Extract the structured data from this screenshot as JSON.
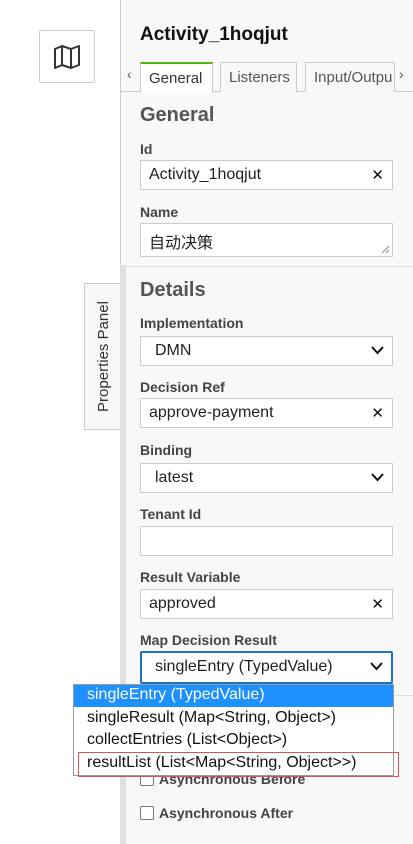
{
  "canvas": {
    "map_icon": "map-icon",
    "properties_panel_toggle": "Properties Panel"
  },
  "panel": {
    "title": "Activity_1hoqjut",
    "tabs": {
      "prev": "‹",
      "next": "›",
      "items": [
        {
          "label": "General",
          "active": true
        },
        {
          "label": "Listeners",
          "active": false
        },
        {
          "label": "Input/Outpu",
          "active": false
        }
      ]
    },
    "general": {
      "title": "General",
      "id_label": "Id",
      "id_value": "Activity_1hoqjut",
      "name_label": "Name",
      "name_value": "自动决策"
    },
    "details": {
      "title": "Details",
      "implementation_label": "Implementation",
      "implementation_value": "DMN",
      "decision_ref_label": "Decision Ref",
      "decision_ref_value": "approve-payment",
      "binding_label": "Binding",
      "binding_value": "latest",
      "tenant_label": "Tenant Id",
      "tenant_value": "",
      "result_var_label": "Result Variable",
      "result_var_value": "approved",
      "map_label": "Map Decision Result",
      "map_value": "singleEntry (TypedValue)",
      "async_before": "Asynchronous Before",
      "async_after": "Asynchronous After"
    },
    "dropdown": {
      "options": [
        "singleEntry (TypedValue)",
        "singleResult (Map<String, Object>)",
        "collectEntries (List<Object>)",
        "resultList (List<Map<String, Object>>)"
      ],
      "selected_index": 0,
      "highlighted_index": 3
    },
    "colors": {
      "accent_tab": "#52b415",
      "focus": "#1a73c7",
      "selected_option": "#1e90ff",
      "highlight_box": "#d9534f"
    }
  }
}
